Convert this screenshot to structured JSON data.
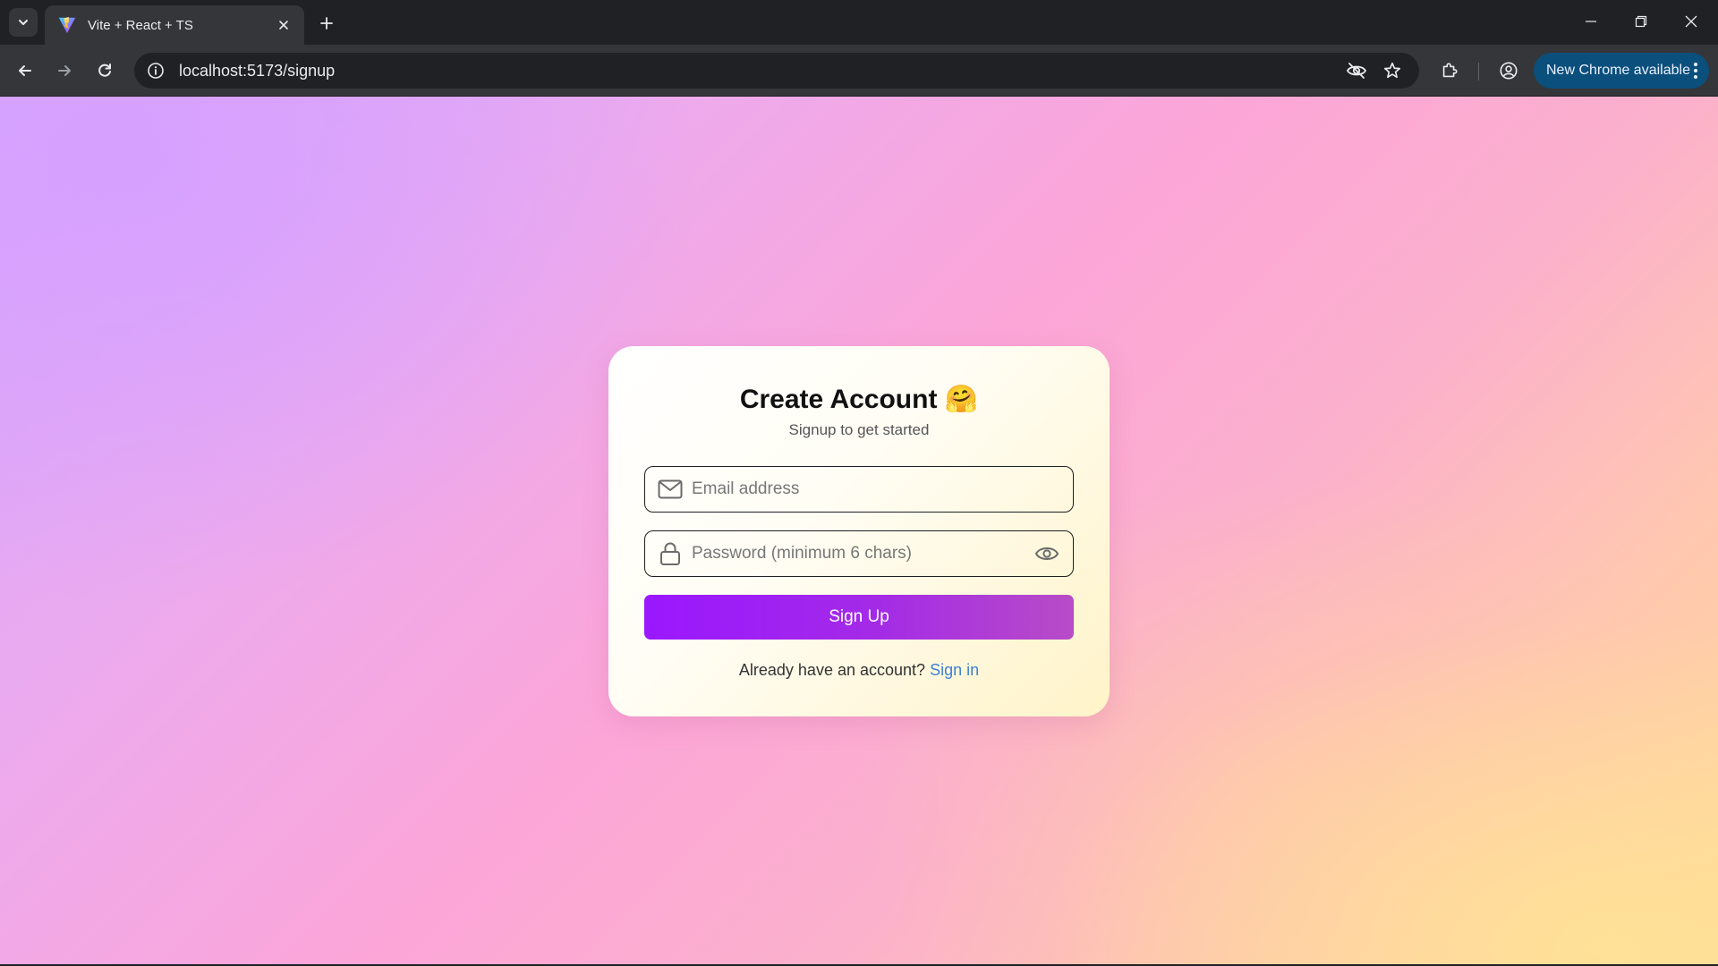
{
  "browser": {
    "tab_title": "Vite + React + TS",
    "url": "localhost:5173/signup",
    "update_label": "New Chrome available"
  },
  "signup": {
    "title": "Create Account",
    "title_emoji": "🤗",
    "subtitle": "Signup to get started",
    "email_placeholder": "Email address",
    "password_placeholder": "Password (minimum 6 chars)",
    "submit_label": "Sign Up",
    "footer_prompt": "Already have an account?",
    "footer_link": "Sign in"
  },
  "colors": {
    "accent": "#9a17ff",
    "link": "#3d7fd8",
    "chrome_update": "#0b4f7c"
  }
}
